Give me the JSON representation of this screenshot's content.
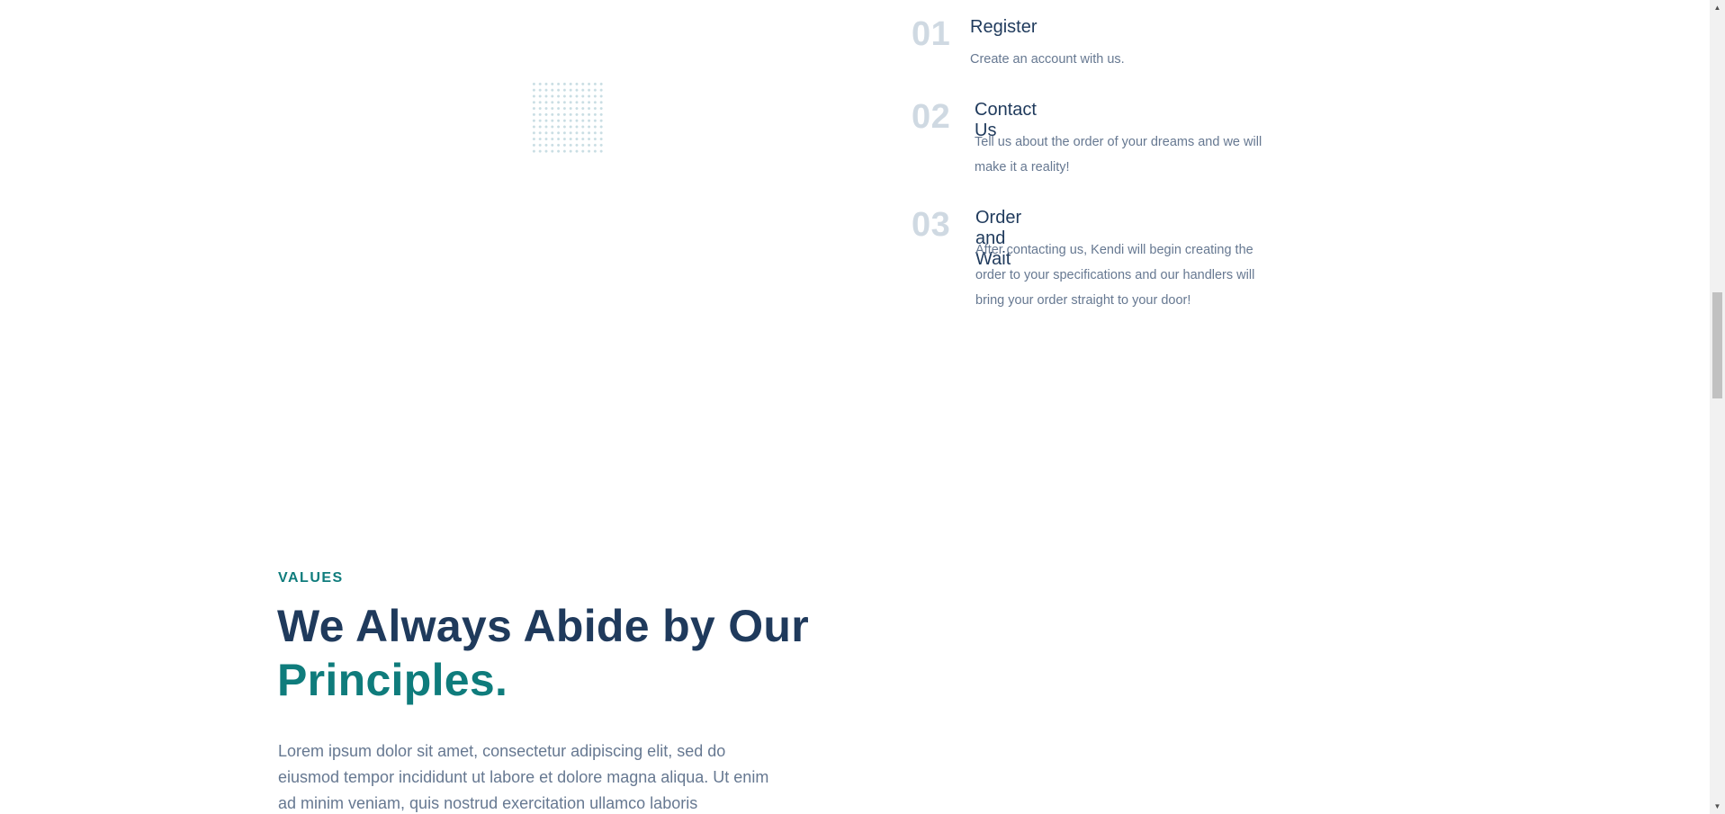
{
  "steps": [
    {
      "number": "01",
      "title": "Register",
      "description": "Create an account with us."
    },
    {
      "number": "02",
      "title": "Contact Us",
      "description": "Tell us about the order of your dreams and we will make it a reality!"
    },
    {
      "number": "03",
      "title": "Order and Wait",
      "description": "After contacting us, Kendi will begin creating the order to your specifications and our handlers will bring your order straight to your door!"
    }
  ],
  "values": {
    "eyebrow": "VALUES",
    "heading_main": "We Always Abide by Our",
    "heading_accent": "Principles.",
    "lead": "Lorem ipsum dolor sit amet, consectetur adipiscing elit, sed do eiusmod tempor incididunt ut labore et dolore magna aliqua. Ut enim ad minim veniam, quis nostrud exercitation ullamco laboris"
  },
  "scrollbar": {
    "up_icon": "scroll-up-arrow-icon",
    "down_icon": "scroll-down-arrow-icon"
  },
  "colors": {
    "navy": "#1f3a5c",
    "teal": "#0f7c7c",
    "muted_text": "#667891",
    "step_number": "#cfd9e2"
  }
}
